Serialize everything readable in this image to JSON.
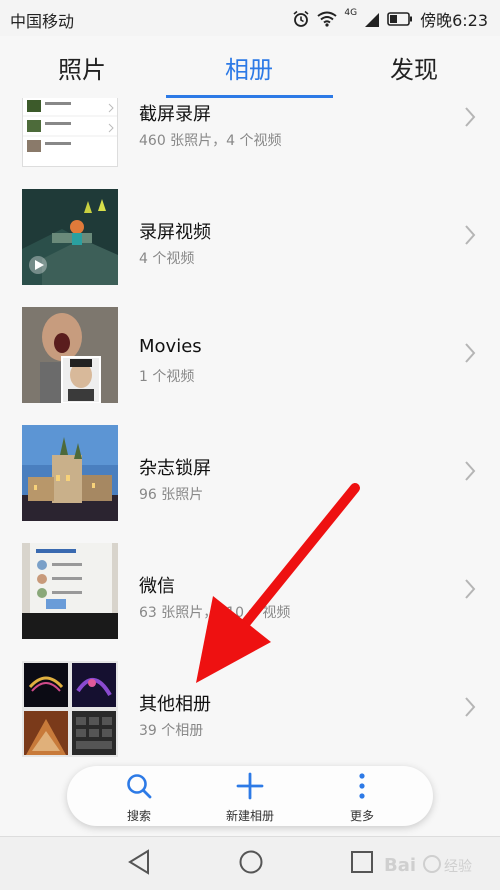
{
  "status_bar": {
    "carrier": "中国移动",
    "time": "傍晚6:23",
    "signal_tag": "4G"
  },
  "tabs": [
    {
      "label": "照片",
      "active": false
    },
    {
      "label": "相册",
      "active": true
    },
    {
      "label": "发现",
      "active": false
    }
  ],
  "albums": [
    {
      "name": "截屏录屏",
      "meta": "460 张照片，4 个视频"
    },
    {
      "name": "录屏视频",
      "meta": "4 个视频"
    },
    {
      "name": "Movies",
      "meta": "1 个视频"
    },
    {
      "name": "杂志锁屏",
      "meta": "96 张照片"
    },
    {
      "name": "微信",
      "meta": "63 张照片，210 个视频"
    },
    {
      "name": "其他相册",
      "meta": "39 个相册"
    }
  ],
  "bottom_actions": {
    "search": "搜索",
    "new_album": "新建相册",
    "more": "更多"
  },
  "colors": {
    "accent": "#2d7ae6",
    "annotation_arrow": "#ee1111"
  },
  "watermark": "Baidu经验"
}
